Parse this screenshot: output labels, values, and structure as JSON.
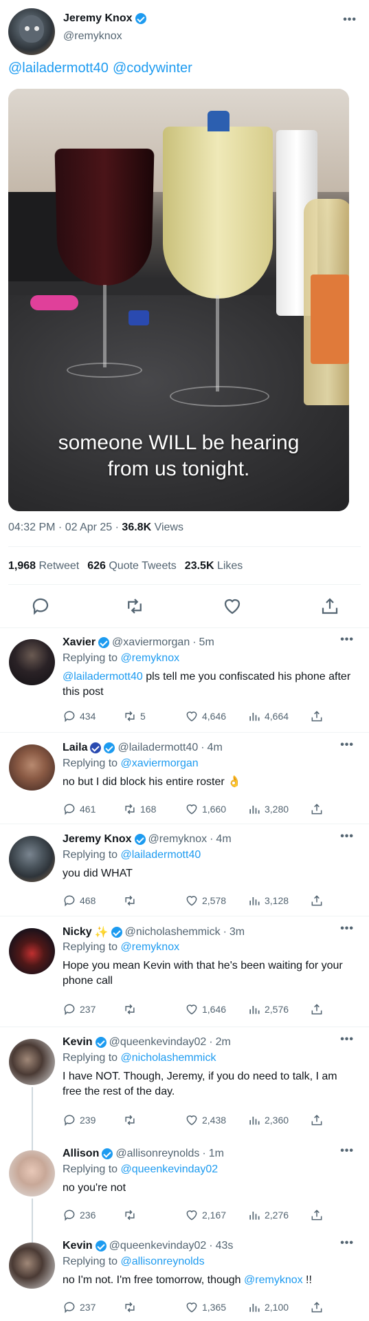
{
  "main_tweet": {
    "author_name": "Jeremy Knox",
    "author_handle": "@remyknox",
    "mentions": [
      "@lailadermott40",
      "@codywinter"
    ],
    "media_caption_line1": "someone WILL be hearing",
    "media_caption_line2": "from us tonight.",
    "time": "04:32 PM",
    "date": "02 Apr 25",
    "views_count": "36.8K",
    "views_label": "Views",
    "retweets_count": "1,968",
    "retweets_label": "Retweet",
    "quotes_count": "626",
    "quotes_label": "Quote Tweets",
    "likes_count": "23.5K",
    "likes_label": "Likes",
    "more": "•••"
  },
  "replies": [
    {
      "name": "Xavier",
      "handle": "@xaviermorgan",
      "time": "5m",
      "replying_prefix": "Replying to",
      "replying_to": "@remyknox",
      "mention": "@lailadermott40",
      "text": " pls tell me you confiscated his phone after this post",
      "replies": "434",
      "retweets": "5",
      "likes": "4,646",
      "views": "4,664"
    },
    {
      "name": "Laila",
      "handle": "@lailadermott40",
      "time": "4m",
      "replying_prefix": "Replying to",
      "replying_to": "@xaviermorgan",
      "text": "no but I did block his entire roster 👌",
      "replies": "461",
      "retweets": "168",
      "likes": "1,660",
      "views": "3,280"
    },
    {
      "name": "Jeremy Knox",
      "handle": "@remyknox",
      "time": "4m",
      "replying_prefix": "Replying to",
      "replying_to": "@lailadermott40",
      "text": "you did WHAT",
      "replies": "468",
      "retweets": "",
      "likes": "2,578",
      "views": "3,128"
    },
    {
      "name": "Nicky",
      "name_emoji": "✨",
      "handle": "@nicholashemmick",
      "time": "3m",
      "replying_prefix": "Replying to",
      "replying_to": "@remyknox",
      "text": "Hope you mean Kevin with that he's been waiting for your phone call",
      "replies": "237",
      "retweets": "",
      "likes": "1,646",
      "views": "2,576"
    },
    {
      "name": "Kevin",
      "handle": "@queenkevinday02",
      "time": "2m",
      "replying_prefix": "Replying to",
      "replying_to": "@nicholashemmick",
      "text": "I have NOT. Though, Jeremy, if you do need to talk, I am free the rest of the day.",
      "replies": "239",
      "retweets": "",
      "likes": "2,438",
      "views": "2,360"
    },
    {
      "name": "Allison",
      "handle": "@allisonreynolds",
      "time": "1m",
      "replying_prefix": "Replying to",
      "replying_to": "@queenkevinday02",
      "text": "no you're not",
      "replies": "236",
      "retweets": "",
      "likes": "2,167",
      "views": "2,276"
    },
    {
      "name": "Kevin",
      "handle": "@queenkevinday02",
      "time": "43s",
      "replying_prefix": "Replying to",
      "replying_to": "@allisonreynolds",
      "text": "no I'm not. I'm free tomorrow, though ",
      "mention_after": "@remyknox",
      "text_after": " !!",
      "replies": "237",
      "retweets": "",
      "likes": "1,365",
      "views": "2,100"
    }
  ],
  "colors": {
    "accent": "#1d9bf0",
    "secondary_text": "#536471",
    "divider": "#eff3f4"
  }
}
